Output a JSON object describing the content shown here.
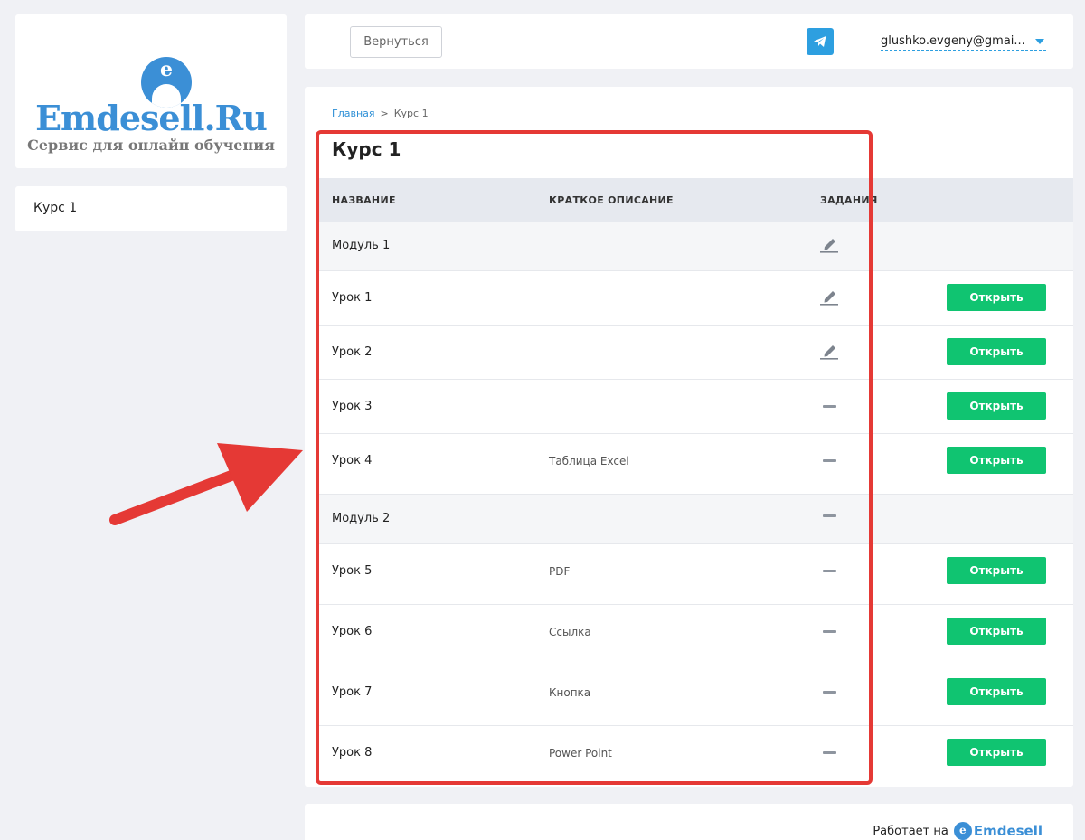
{
  "brand": {
    "logo_letter": "e",
    "name": "Emdesell.Ru",
    "tagline": "Сервис для онлайн обучения"
  },
  "sidebar": {
    "items": [
      {
        "label": "Курс 1"
      }
    ]
  },
  "header": {
    "back_label": "Вернуться",
    "telegram_icon": "telegram-icon",
    "user_email": "glushko.evgeny@gmai..."
  },
  "breadcrumb": {
    "home": "Главная",
    "separator": ">",
    "current": "Курс 1"
  },
  "page_title": "Курс 1",
  "table": {
    "columns": [
      "НАЗВАНИЕ",
      "КРАТКОЕ ОПИСАНИЕ",
      "ЗАДАНИЯ"
    ],
    "rows": [
      {
        "type": "module",
        "name": "Модуль 1",
        "description": "",
        "task": "pencil"
      },
      {
        "type": "lesson",
        "name": "Урок 1",
        "description": "",
        "task": "pencil",
        "action": "Открыть"
      },
      {
        "type": "lesson",
        "name": "Урок 2",
        "description": "",
        "task": "pencil",
        "action": "Открыть"
      },
      {
        "type": "lesson",
        "name": "Урок 3",
        "description": "",
        "task": "dash",
        "action": "Открыть"
      },
      {
        "type": "lesson",
        "name": "Урок 4",
        "description": "Таблица Excel",
        "task": "dash",
        "action": "Открыть"
      },
      {
        "type": "module",
        "name": "Модуль 2",
        "description": "",
        "task": "dash"
      },
      {
        "type": "lesson",
        "name": "Урок 5",
        "description": "PDF",
        "task": "dash",
        "action": "Открыть"
      },
      {
        "type": "lesson",
        "name": "Урок 6",
        "description": "Ссылка",
        "task": "dash",
        "action": "Открыть"
      },
      {
        "type": "lesson",
        "name": "Урок 7",
        "description": "Кнопка",
        "task": "dash",
        "action": "Открыть"
      },
      {
        "type": "lesson",
        "name": "Урок 8",
        "description": "Power Point",
        "task": "dash",
        "action": "Открыть"
      }
    ]
  },
  "footer": {
    "powered_by": "Работает на",
    "brand_letter": "e",
    "brand": "Emdesell"
  },
  "colors": {
    "accent": "#3b8fd6",
    "open_button": "#10c471",
    "telegram": "#2d9fe0",
    "annotation": "#e53935"
  }
}
